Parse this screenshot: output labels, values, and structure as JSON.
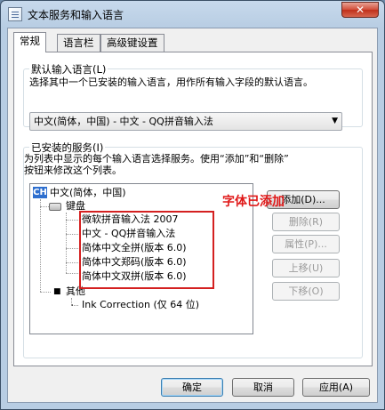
{
  "window": {
    "title": "文本服务和输入语言",
    "close_label": "✕"
  },
  "tabs": [
    {
      "label": "常规",
      "active": true
    },
    {
      "label": "语言栏",
      "active": false
    },
    {
      "label": "高级键设置",
      "active": false
    }
  ],
  "default_language": {
    "group_label": "默认输入语言(L)",
    "description": "选择其中一个已安装的输入语言，用作所有输入字段的默认语言。",
    "selected": "中文(简体，中国) - 中文 - QQ拼音输入法"
  },
  "installed_services": {
    "group_label": "已安装的服务(I)",
    "description_line1": "为列表中显示的每个输入语言选择服务。使用“添加”和“删除”",
    "description_line2": "按钮来修改这个列表。",
    "tree": {
      "language_badge": "CH",
      "language": "中文(简体，中国)",
      "keyboard_label": "键盘",
      "keyboards": [
        "微软拼音输入法 2007",
        "中文 - QQ拼音输入法",
        "简体中文全拼(版本 6.0)",
        "简体中文郑码(版本 6.0)",
        "简体中文双拼(版本 6.0)"
      ],
      "other_label": "其他",
      "other_items": [
        "Ink Correction (仅 64 位)"
      ]
    }
  },
  "side_buttons": {
    "add": "添加(D)...",
    "remove": "删除(R)",
    "properties": "属性(P)...",
    "move_up": "上移(U)",
    "move_down": "下移(O)"
  },
  "footer_buttons": {
    "ok": "确定",
    "cancel": "取消",
    "apply": "应用(A)"
  },
  "annotation": "字体已添加",
  "colors": {
    "annotation": "#e01818",
    "highlight_border": "#d42020",
    "language_badge": "#2e6fcf"
  }
}
